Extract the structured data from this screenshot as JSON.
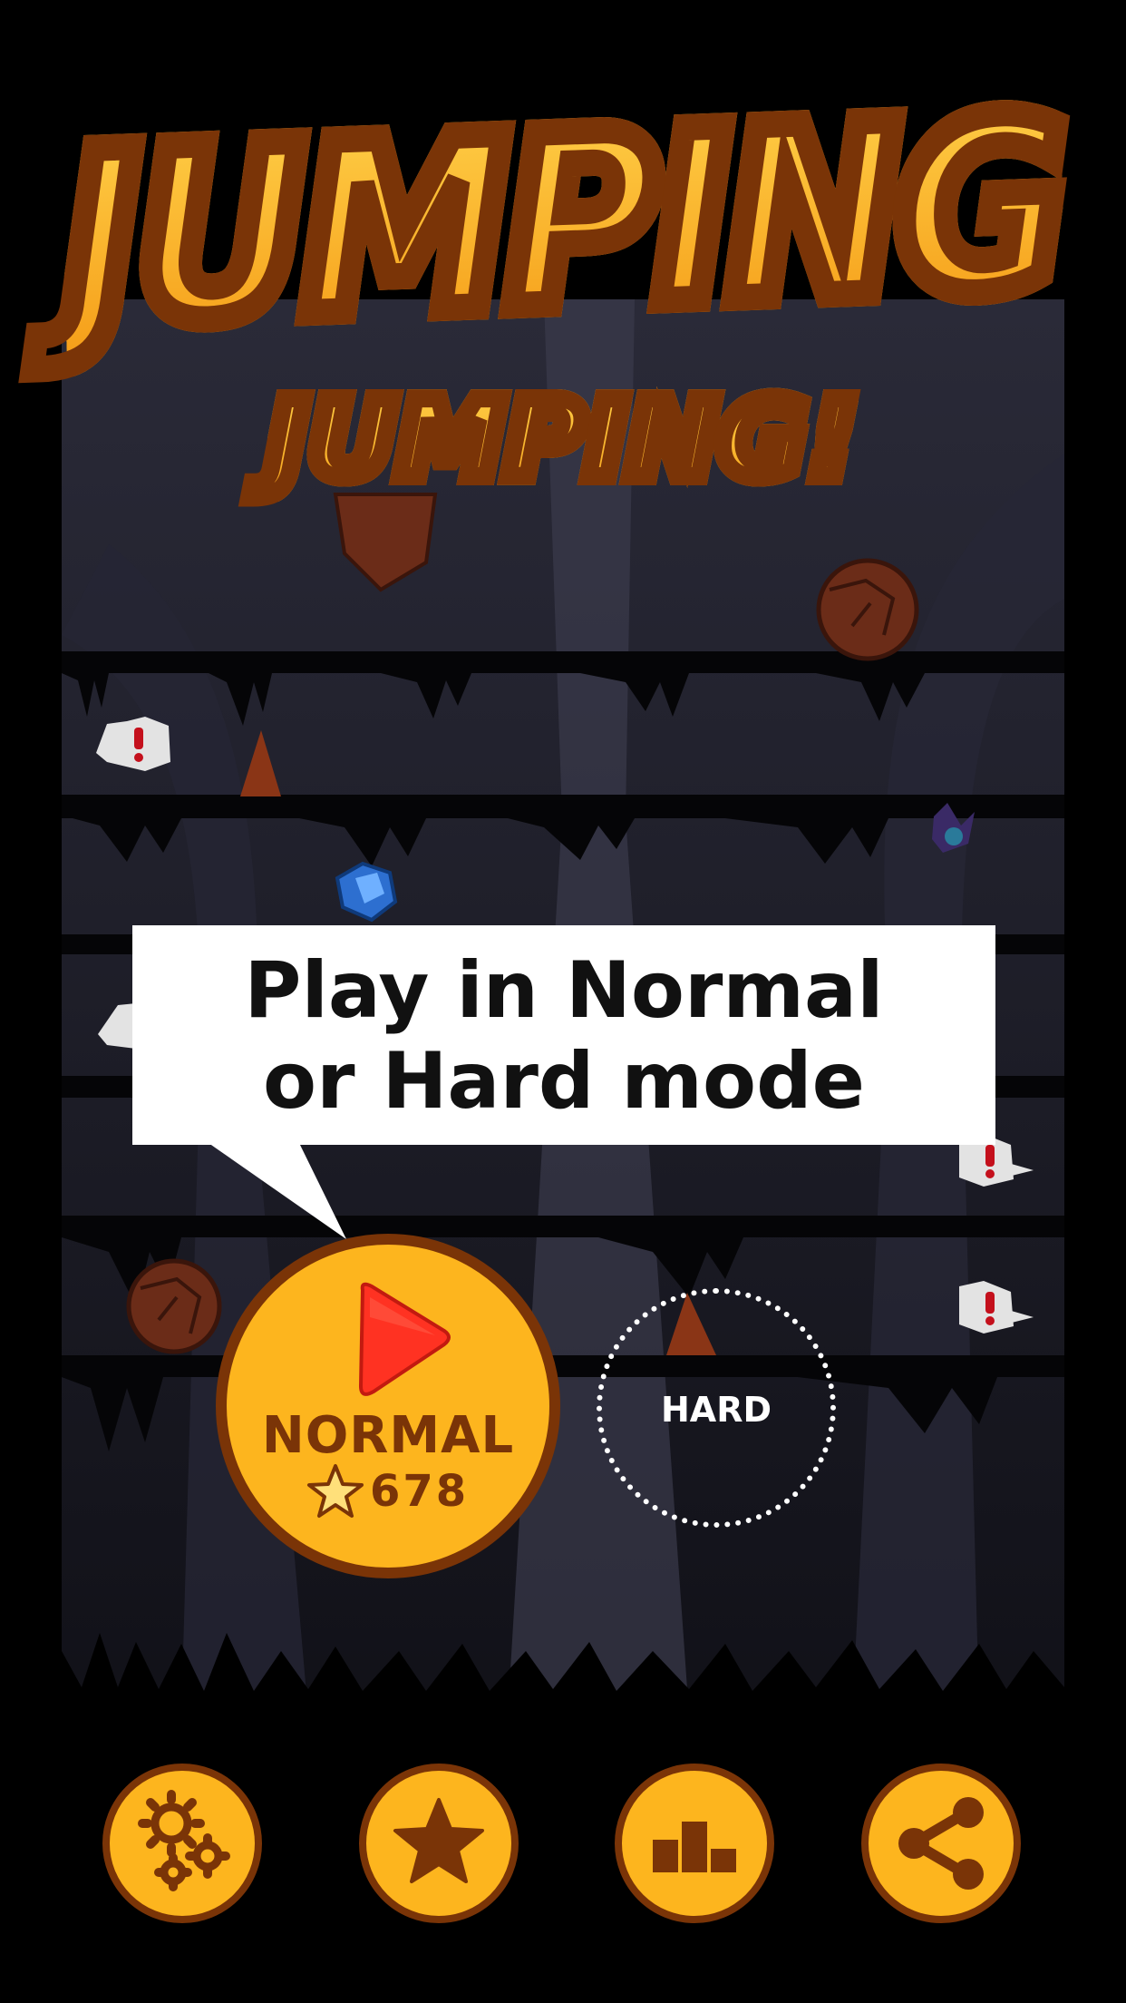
{
  "title": {
    "main": "JUMPING",
    "sub": "JUMPING!"
  },
  "tip": {
    "line1": "Play in Normal",
    "line2": "or Hard mode"
  },
  "modes": {
    "normal": {
      "label": "NORMAL",
      "score": "678",
      "icon": "play-icon",
      "color": "#fdb51e"
    },
    "hard": {
      "label": "HARD"
    }
  },
  "bottom_bar": [
    {
      "id": "settings",
      "icon": "gears-icon"
    },
    {
      "id": "rate",
      "icon": "star-icon"
    },
    {
      "id": "leaderboard",
      "icon": "leaderboard-icon"
    },
    {
      "id": "share",
      "icon": "share-icon"
    }
  ],
  "colors": {
    "accent": "#fdb51e",
    "outline": "#7a3407",
    "play": "#ff3222",
    "alert": "#c4101c"
  }
}
